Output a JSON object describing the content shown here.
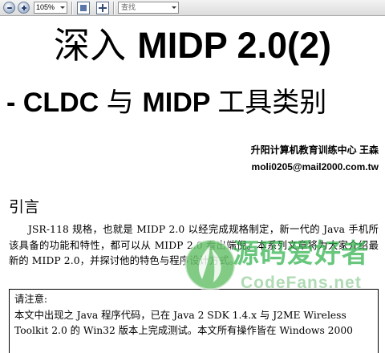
{
  "toolbar": {
    "zoom_out_icon": "zoom-out-icon",
    "zoom_in_icon": "zoom-in-icon",
    "zoom_value": "105%",
    "fit_page_icon": "fit-page-icon",
    "fit_width_icon": "fit-width-icon",
    "search_placeholder": "查找"
  },
  "document": {
    "title_line1_cn": "深入 ",
    "title_line1_latin": "MIDP 2.0(2)",
    "title_line2_prefix": "- CLDC ",
    "title_line2_cn1": "与 ",
    "title_line2_latin": "MIDP ",
    "title_line2_cn2": "工具类别",
    "author_org": "升阳计算机教育训练中心  王森",
    "author_email": "moli0205@mail2000.com.tw",
    "section_title": "引言",
    "intro_paragraph": "JSR-118 规格，也就是 MIDP 2.0 以经完成规格制定，新一代的 Java 手机所该具备的功能和特性，都可以从 MIDP 2.0 看出端倪。本系列文章将为大家介绍最新的 MIDP 2.0，并探讨他的特色与程序设计方式。",
    "notice_title": "请注意:",
    "notice_line1": "本文中出现之 Java 程序代码，已在 Java 2 SDK 1.4.x 与 J2ME Wireless",
    "notice_line2": "Toolkit   2.0 的 Win32 版本上完成测试。本文所有操作皆在 Windows 2000"
  },
  "watermark": {
    "text_cn": "源码爱好者",
    "text_en": "CodeFans.net",
    "color": "#2fb24a"
  }
}
